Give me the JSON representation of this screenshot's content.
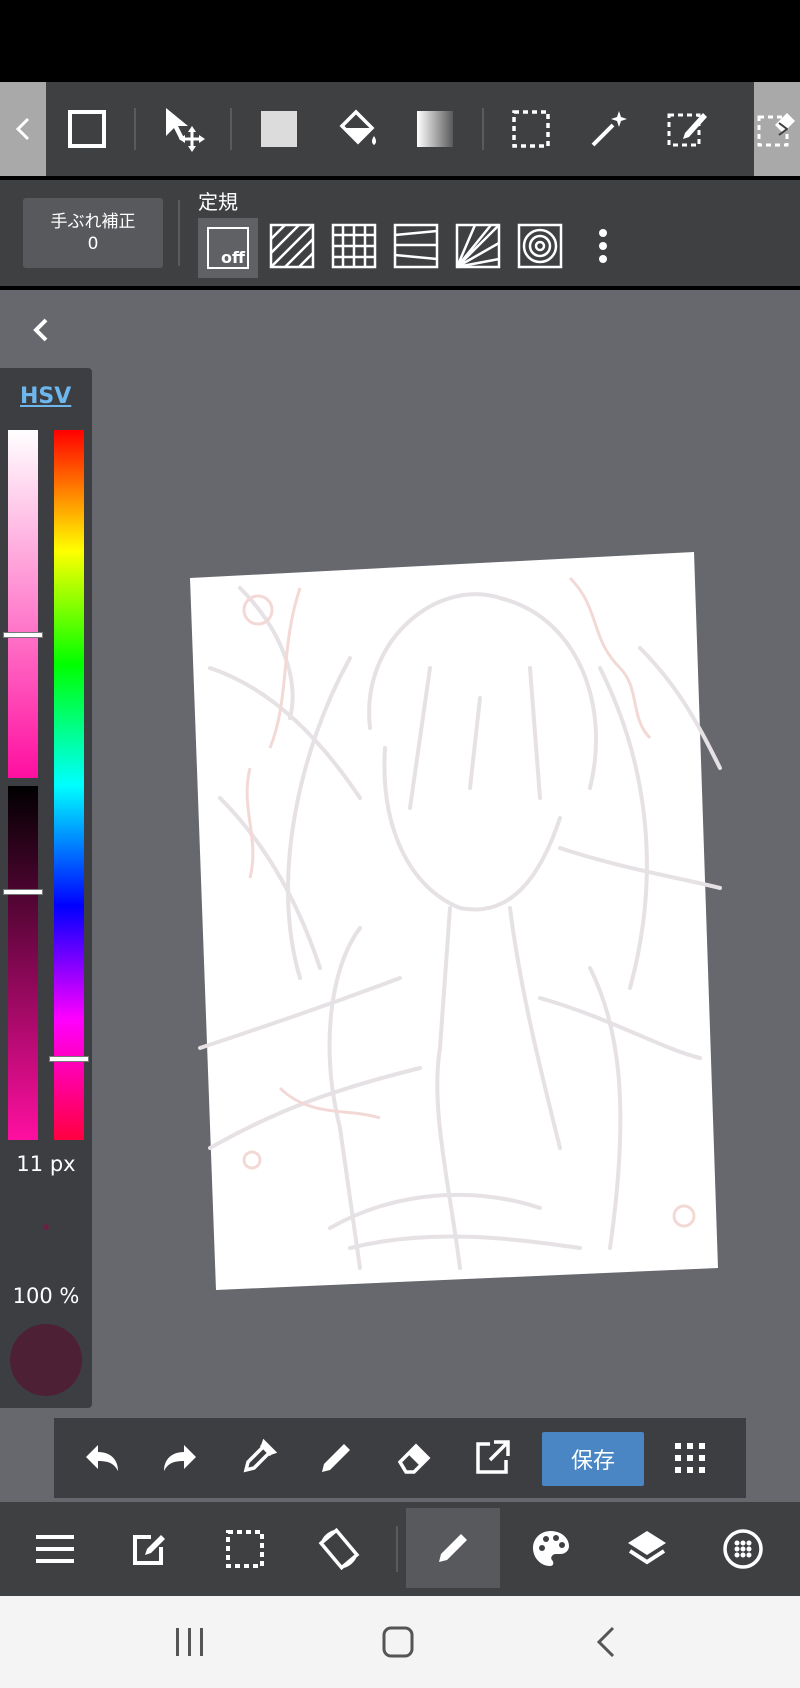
{
  "top_toolbar": {
    "tools": [
      "edge-left-tool",
      "shape-rectangle-tool",
      "move-tool",
      "fill-square-tool",
      "bucket-fill-tool",
      "gradient-tool",
      "select-rectangle-tool",
      "magic-wand-tool",
      "select-pen-tool",
      "select-eraser-tool"
    ]
  },
  "sub_toolbar": {
    "stabilizer_label": "手ぶれ補正",
    "stabilizer_value": "0",
    "ruler_label": "定規",
    "ruler_off": "off"
  },
  "palette": {
    "mode_label": "HSV",
    "brush_size": "11 px",
    "opacity": "100 %",
    "current_color": "#4d2035",
    "hue_pos": 0.9,
    "saturation_pos": 0.6,
    "value_pos": 0.31
  },
  "bottom_actions": {
    "save_label": "保存"
  },
  "colors": {
    "accent": "#4a86c4",
    "toolbar_bg": "#3f4042",
    "canvas_bg": "#66686d"
  }
}
